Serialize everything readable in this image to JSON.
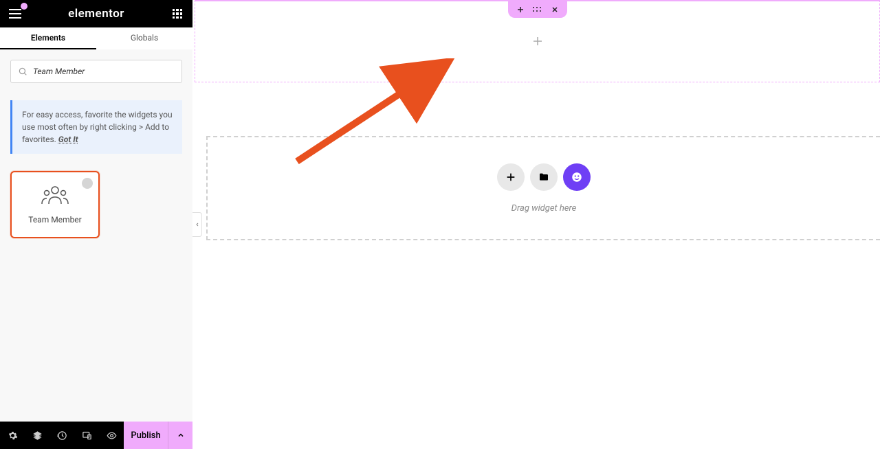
{
  "header": {
    "logo": "elementor"
  },
  "tabs": {
    "elements": "Elements",
    "globals": "Globals"
  },
  "search": {
    "value": "Team Member"
  },
  "tip": {
    "text": "For easy access, favorite the widgets you use most often by right clicking > Add to favorites.",
    "gotit": "Got It"
  },
  "widget": {
    "label": "Team Member"
  },
  "footer": {
    "publish": "Publish"
  },
  "dropzone": {
    "text": "Drag widget here"
  }
}
